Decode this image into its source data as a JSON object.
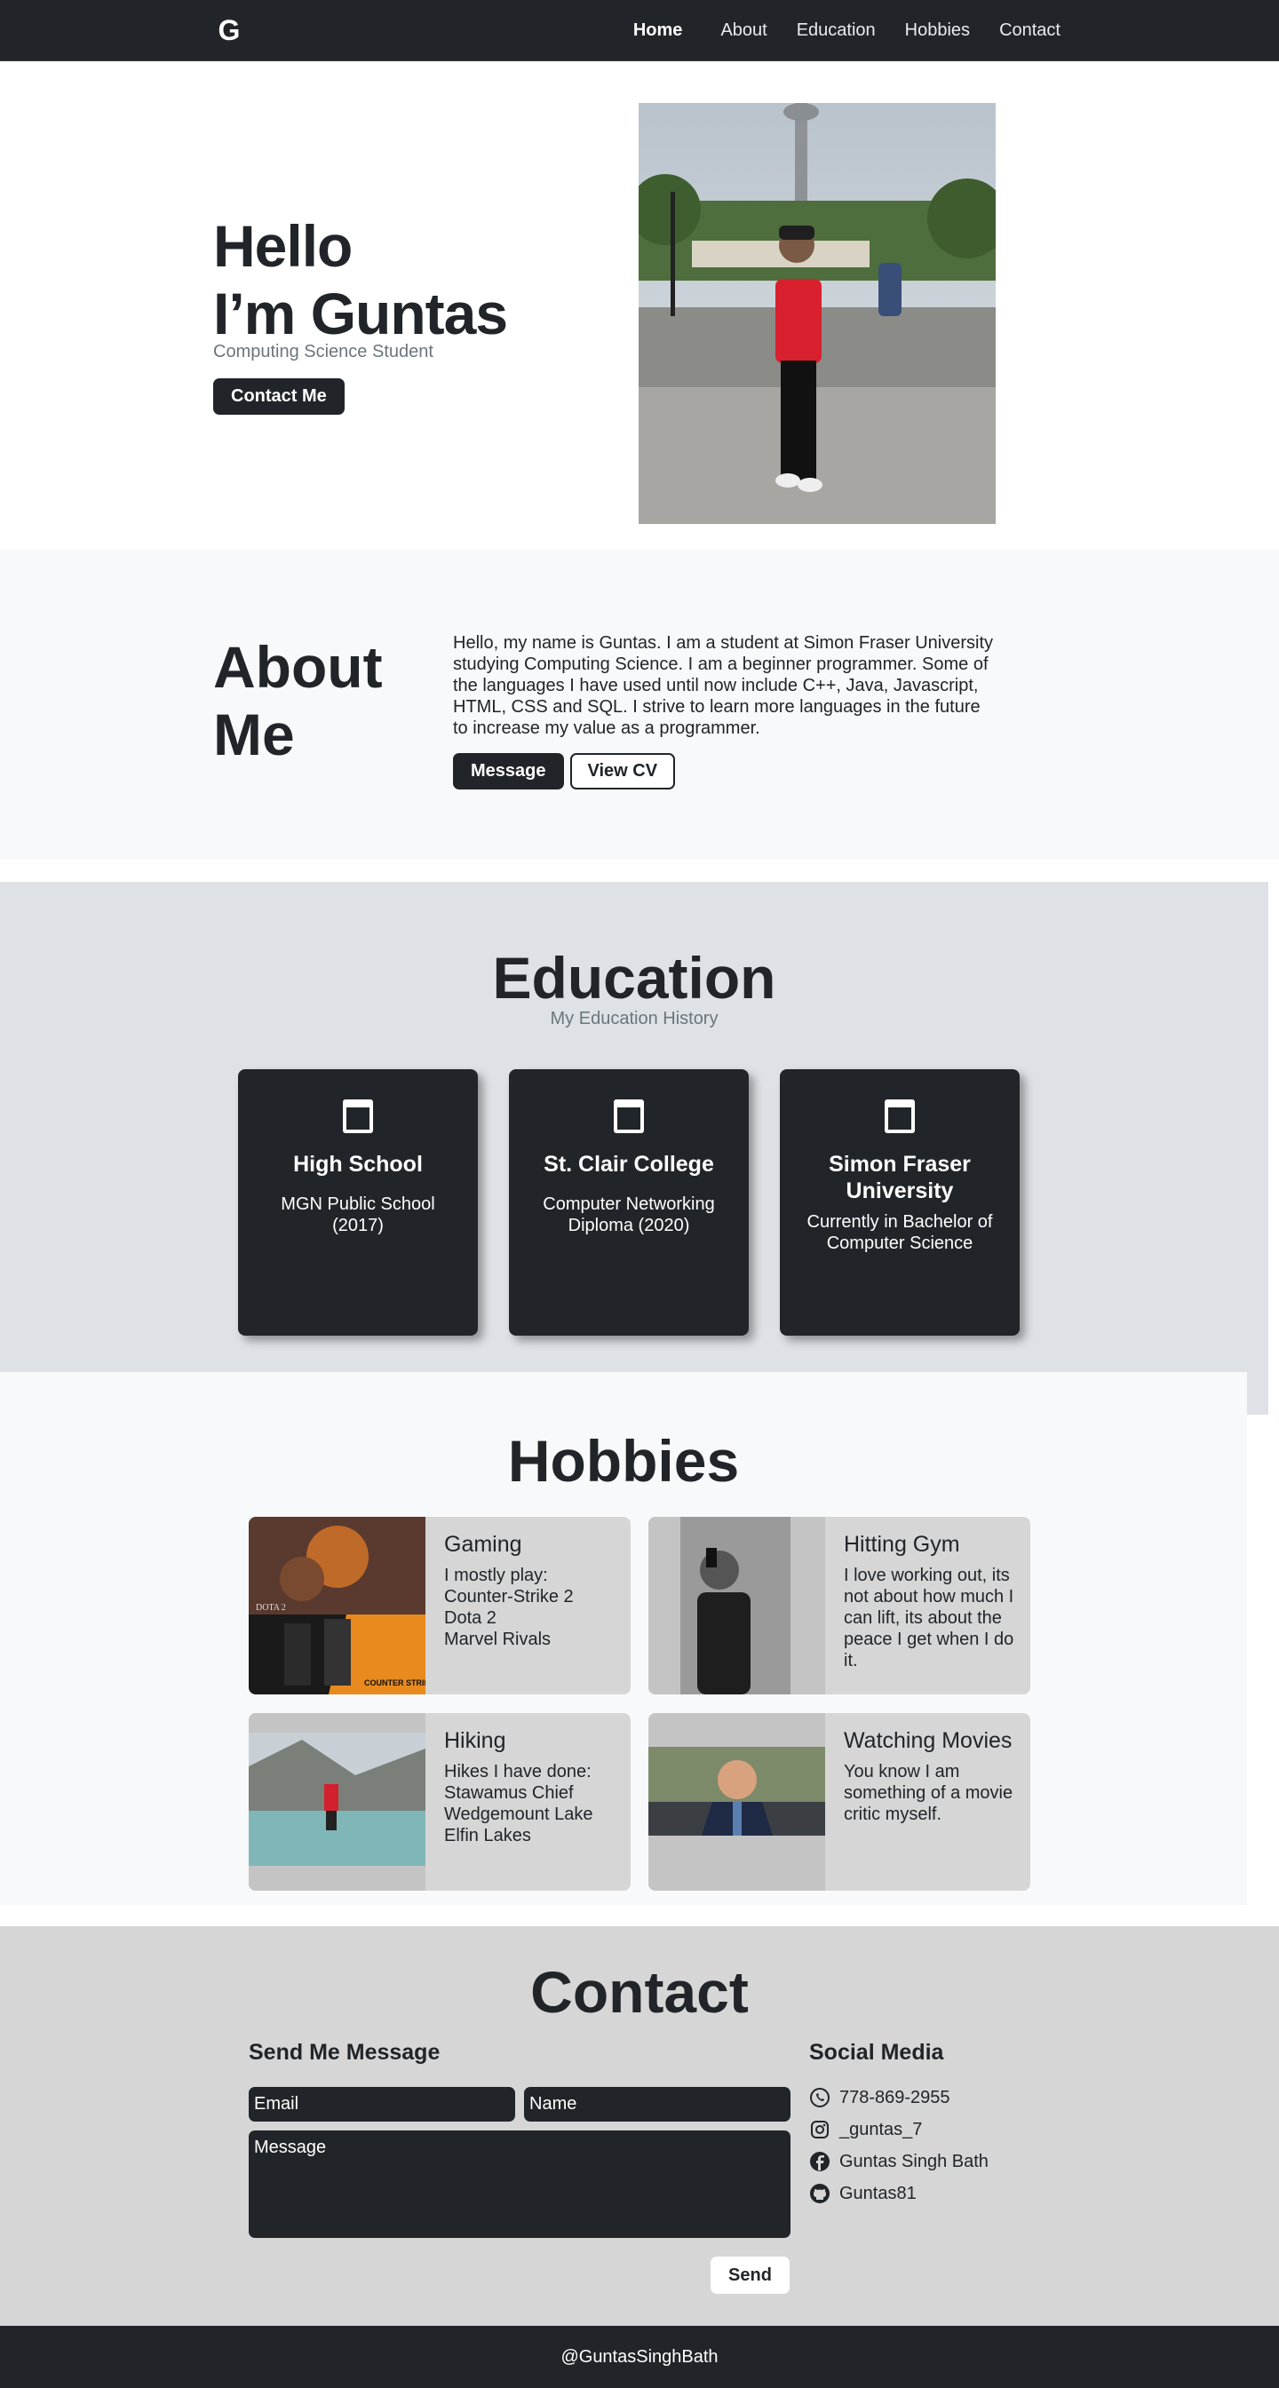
{
  "nav": {
    "logo": "G",
    "links": [
      "Home",
      "About",
      "Education",
      "Hobbies",
      "Contact"
    ]
  },
  "hero": {
    "line1": "Hello",
    "line2": "I’m Guntas",
    "subtitle": "Computing Science Student",
    "cta": "Contact Me"
  },
  "about": {
    "title_line1": "About",
    "title_line2": "Me",
    "body": "Hello, my name is Guntas. I am a student at Simon Fraser University studying Computing Science. I am a beginner programmer. Some of the languages I have used until now include C++, Java, Javascript, HTML, CSS and SQL. I strive to learn more languages in the future to increase my value as a programmer.",
    "btn_message": "Message",
    "btn_cv": "View CV"
  },
  "education": {
    "title": "Education",
    "subtitle": "My Education History",
    "cards": [
      {
        "title": "High School",
        "desc": "MGN Public School (2017)"
      },
      {
        "title": "St. Clair College",
        "desc": "Computer Networking Diploma (2020)"
      },
      {
        "title": "Simon Fraser University",
        "desc": "Currently in Bachelor of Computer Science"
      }
    ]
  },
  "hobbies": {
    "title": "Hobbies",
    "items": [
      {
        "title": "Gaming",
        "lines": [
          "I mostly play:",
          "Counter-Strike 2",
          "Dota 2",
          "Marvel Rivals"
        ]
      },
      {
        "title": "Hitting Gym",
        "lines": [
          "I love working out, its not about how much I can lift, its about the peace I get when I do it."
        ]
      },
      {
        "title": "Hiking",
        "lines": [
          "Hikes I have done:",
          "Stawamus Chief",
          "Wedgemount Lake",
          "Elfin Lakes"
        ]
      },
      {
        "title": "Watching Movies",
        "lines": [
          "You know I am something of a movie critic myself."
        ]
      }
    ],
    "image_text": {
      "dota": "DOTA 2",
      "cs": "COUNTER STRIKE"
    }
  },
  "contact": {
    "title": "Contact",
    "form_heading": "Send Me Message",
    "email_placeholder": "Email",
    "name_placeholder": "Name",
    "message_placeholder": "Message",
    "send": "Send",
    "social_heading": "Social Media",
    "social": [
      {
        "icon": "whatsapp-icon",
        "text": "778-869-2955"
      },
      {
        "icon": "instagram-icon",
        "text": "_guntas_7"
      },
      {
        "icon": "facebook-icon",
        "text": "Guntas Singh Bath"
      },
      {
        "icon": "github-icon",
        "text": "Guntas81"
      }
    ]
  },
  "footer": {
    "text": "@GuntasSinghBath"
  }
}
